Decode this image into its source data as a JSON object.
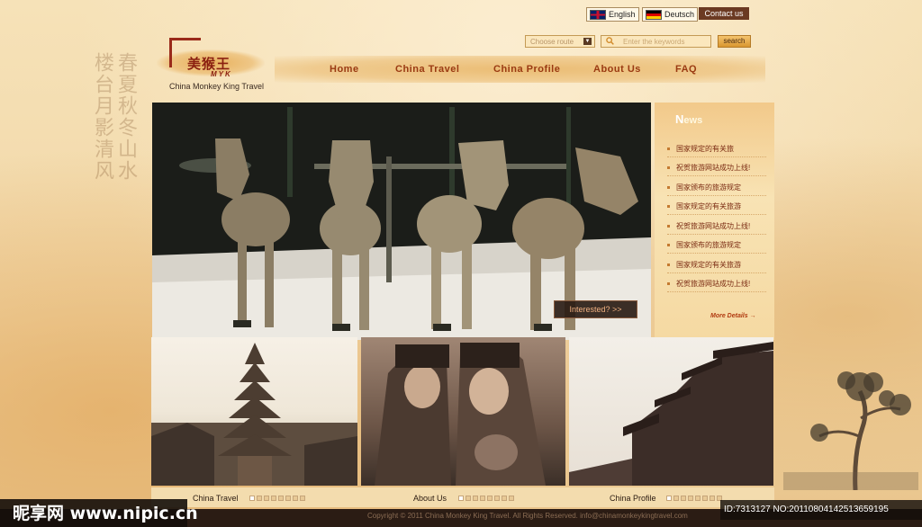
{
  "header": {
    "languages": [
      {
        "label": "English",
        "flag": "uk-flag-icon"
      },
      {
        "label": "Deutsch",
        "flag": "german-flag-icon"
      }
    ],
    "contact_label": "Contact us",
    "route_placeholder": "Choose route",
    "search_placeholder": "Enter the keywords",
    "search_button": "search"
  },
  "logo": {
    "chinese": "美猴王",
    "abbr": "MYK",
    "tagline": "China Monkey King Travel"
  },
  "nav": [
    "Home",
    "China Travel",
    "China Profile",
    "About Us",
    "FAQ"
  ],
  "hero": {
    "cta_label": "Interested? >>"
  },
  "news": {
    "title_first": "N",
    "title_rest": "ews",
    "items": [
      "国家规定的有关旅",
      "祝贺旅游网站成功上线!",
      "国家颁布的旅游规定",
      "国家规定的有关旅游",
      "祝贺旅游网站成功上线!",
      "国家颁布的旅游规定",
      "国家规定的有关旅游",
      "祝贺旅游网站成功上线!"
    ],
    "more_label": "More Details  →"
  },
  "captions": [
    "China Travel",
    "About Us",
    "China Profile"
  ],
  "footer": {
    "copyright": "Copyright © 2011 China Monkey King Travel. All Rights Reserved.   info@chinamonkeykingtravel.com"
  },
  "watermark": {
    "site": "昵享网 www.nipic.cn",
    "id": "ID:7313127 NO:20110804142513659195"
  },
  "colors": {
    "accent": "#9a3a12",
    "footer": "#2b1c14",
    "paper": "#f3dcae"
  }
}
